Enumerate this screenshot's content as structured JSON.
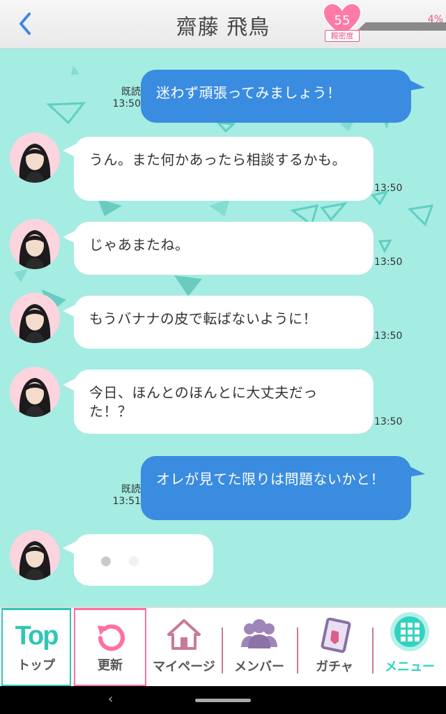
{
  "header": {
    "title": "齋藤 飛鳥",
    "intimacy_level": "55",
    "intimacy_label": "親密度",
    "progress_text": "4%",
    "progress_fraction": 0.04
  },
  "messages": [
    {
      "type": "outgoing",
      "text": "迷わず頑張ってみましょう！",
      "read": "既読",
      "time": "13:50"
    },
    {
      "type": "incoming",
      "text": "うん。また何かあったら相談するかも。",
      "time": "13:50"
    },
    {
      "type": "incoming",
      "text": "じゃあまたね。",
      "time": "13:50"
    },
    {
      "type": "incoming",
      "text": "もうバナナの皮で転ばないように！",
      "time": "13:50"
    },
    {
      "type": "incoming",
      "text": "今日、ほんとのほんとに大丈夫だった！？",
      "time": "13:50"
    },
    {
      "type": "outgoing",
      "text": "オレが見てた限りは問題ないかと！",
      "read": "既読",
      "time": "13:51"
    }
  ],
  "nav": {
    "top_logo": "Top",
    "top": "トップ",
    "refresh": "更新",
    "mypage": "マイページ",
    "member": "メンバー",
    "gacha": "ガチャ",
    "menu": "メニュー"
  },
  "colors": {
    "chat_bg": "#a5ece2",
    "outgoing_bubble": "#3a8ce0",
    "accent_pink": "#ff6f9f",
    "menu_green": "#30d3bf"
  },
  "icons": {
    "back": "chevron-left-icon",
    "intimacy": "heart-icon",
    "refresh": "refresh-icon",
    "mypage": "house-icon",
    "member": "people-icon",
    "gacha": "card-icon",
    "menu": "grid-icon"
  }
}
